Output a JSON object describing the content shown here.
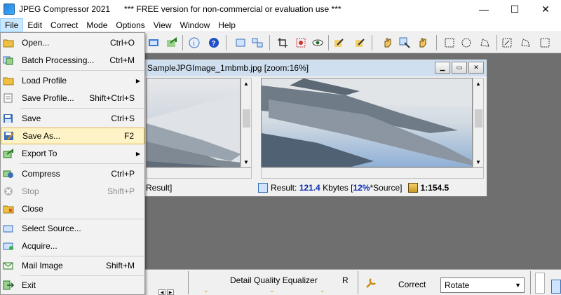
{
  "window": {
    "title": "JPEG Compressor 2021      *** FREE version for non-commercial or evaluation use ***",
    "minimize": "—",
    "maximize": "☐",
    "close": "✕"
  },
  "menubar": [
    "File",
    "Edit",
    "Correct",
    "Mode",
    "Options",
    "View",
    "Window",
    "Help"
  ],
  "file_menu": {
    "items": [
      {
        "label": "Open...",
        "shortcut": "Ctrl+O",
        "icon": "open-folder-icon"
      },
      {
        "label": "Batch Processing...",
        "shortcut": "Ctrl+M",
        "icon": "batch-icon"
      },
      {
        "label": "Load Profile",
        "shortcut": "",
        "submenu": true,
        "icon": "load-profile-icon"
      },
      {
        "label": "Save Profile...",
        "shortcut": "Shift+Ctrl+S",
        "icon": "save-profile-icon"
      },
      {
        "label": "Save",
        "shortcut": "Ctrl+S",
        "icon": "save-icon"
      },
      {
        "label": "Save As...",
        "shortcut": "F2",
        "icon": "save-as-icon",
        "highlighted": true
      },
      {
        "label": "Export To",
        "shortcut": "",
        "submenu": true,
        "icon": "export-icon"
      },
      {
        "label": "Compress",
        "shortcut": "Ctrl+P",
        "icon": "compress-icon"
      },
      {
        "label": "Stop",
        "shortcut": "Shift+P",
        "icon": "stop-icon",
        "disabled": true
      },
      {
        "label": "Close",
        "shortcut": "",
        "icon": "close-folder-icon"
      },
      {
        "label": "Select Source...",
        "shortcut": "",
        "icon": "select-source-icon"
      },
      {
        "label": "Acquire...",
        "shortcut": "",
        "icon": "acquire-icon"
      },
      {
        "label": "Mail Image",
        "shortcut": "Shift+M",
        "icon": "mail-icon"
      },
      {
        "label": "Exit",
        "shortcut": "",
        "icon": "exit-icon"
      }
    ]
  },
  "image_window": {
    "title": "SampleJPGImage_1mbmb.jpg  [zoom:16%]",
    "left_status": "Result]",
    "result_label": "Result:",
    "result_size": "121.4",
    "result_unit": "Kbytes",
    "percent_prefix": "[",
    "percent": "12%",
    "percent_suffix": "*Source]",
    "ratio": "1:154.5"
  },
  "bottom_panel": {
    "equalizer_label": "Detail Quality Equalizer",
    "equalizer_r": "R",
    "correct_label": "Correct",
    "rotate_value": "Rotate"
  },
  "colors": {
    "accent_blue": "#0a2bb0",
    "menu_highlight": "#fdf3c6",
    "workspace": "#6f6f6f"
  }
}
